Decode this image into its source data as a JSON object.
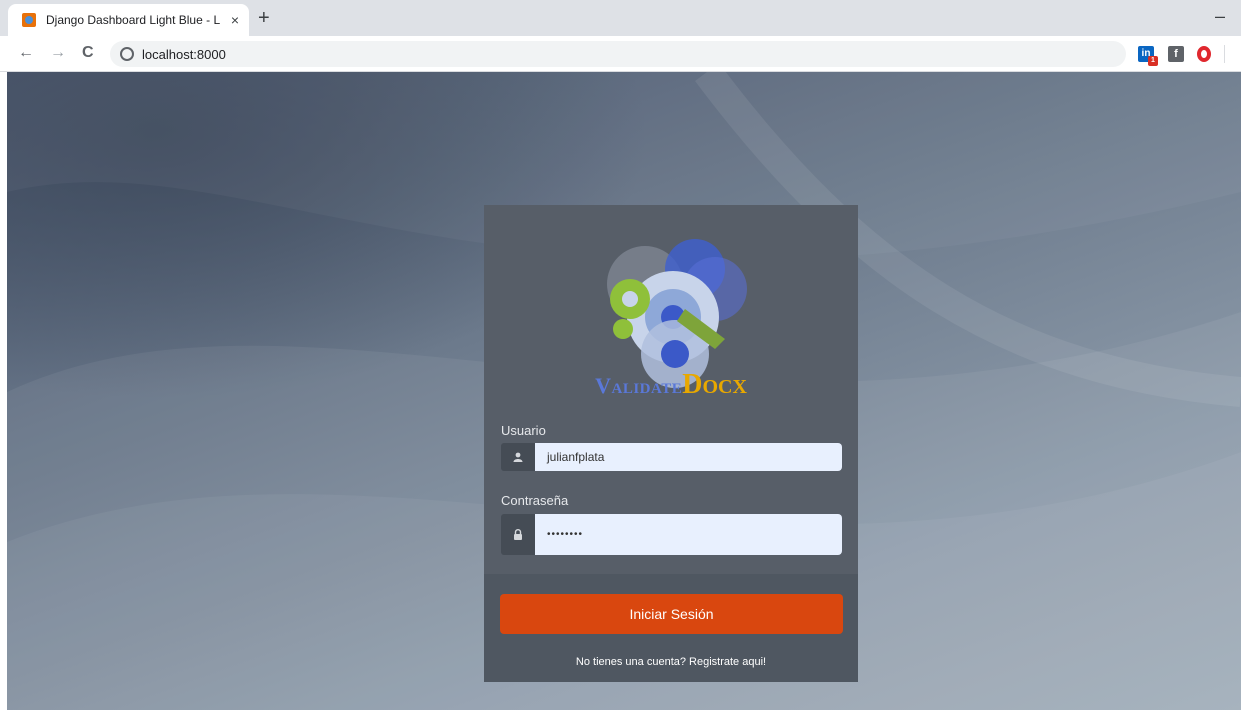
{
  "browser": {
    "tab_title": "Django Dashboard Light Blue - L",
    "tab_close": "×",
    "new_tab": "+",
    "minimize": "–",
    "nav": {
      "back": "←",
      "forward": "→",
      "reload": "C"
    },
    "url": "localhost:8000",
    "extensions": {
      "linkedin": "in",
      "linkedin_badge": "1",
      "facebook": "f"
    }
  },
  "login": {
    "brand_part1": "Validate",
    "brand_part2": "Docx",
    "username_label": "Usuario",
    "username_value": "julianfplata",
    "password_label": "Contraseña",
    "password_value": "••••••••",
    "submit_label": "Iniciar Sesión",
    "register_text": "No tienes una cuenta? Registrate aqui!"
  },
  "colors": {
    "submit": "#d9470f",
    "card": "#575e68",
    "input_bg": "#e8f0fe",
    "brand_blue": "#5a78d8",
    "brand_gold": "#e8a800"
  }
}
